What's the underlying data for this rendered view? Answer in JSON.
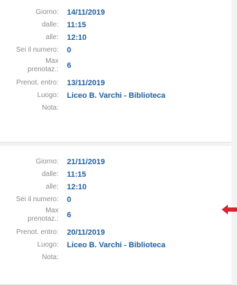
{
  "labels": {
    "giorno": "Giorno:",
    "dalle": "dalle:",
    "alle": "alle:",
    "sei_numero": "Sei il numero:",
    "max_line1": "Max",
    "max_line2": "prenotaz.:",
    "prenot_entro": "Prenot. entro:",
    "luogo": "Luogo:",
    "nota": "Nota:"
  },
  "cards": [
    {
      "giorno": "14/11/2019",
      "dalle": "11:15",
      "alle": "12:10",
      "sei_numero": "0",
      "max_prenotaz": "6",
      "prenot_entro": "13/11/2019",
      "luogo": "Liceo B. Varchi - Biblioteca",
      "nota": ""
    },
    {
      "giorno": "21/11/2019",
      "dalle": "11:15",
      "alle": "12:10",
      "sei_numero": "0",
      "max_prenotaz": "6",
      "prenot_entro": "20/11/2019",
      "luogo": "Liceo B. Varchi - Biblioteca",
      "nota": ""
    }
  ],
  "colors": {
    "value_text": "#1f5f9e",
    "label_text": "#8c8c8c",
    "arrow": "#d9232e"
  },
  "icons": {
    "annotation": "arrow-left-icon"
  }
}
